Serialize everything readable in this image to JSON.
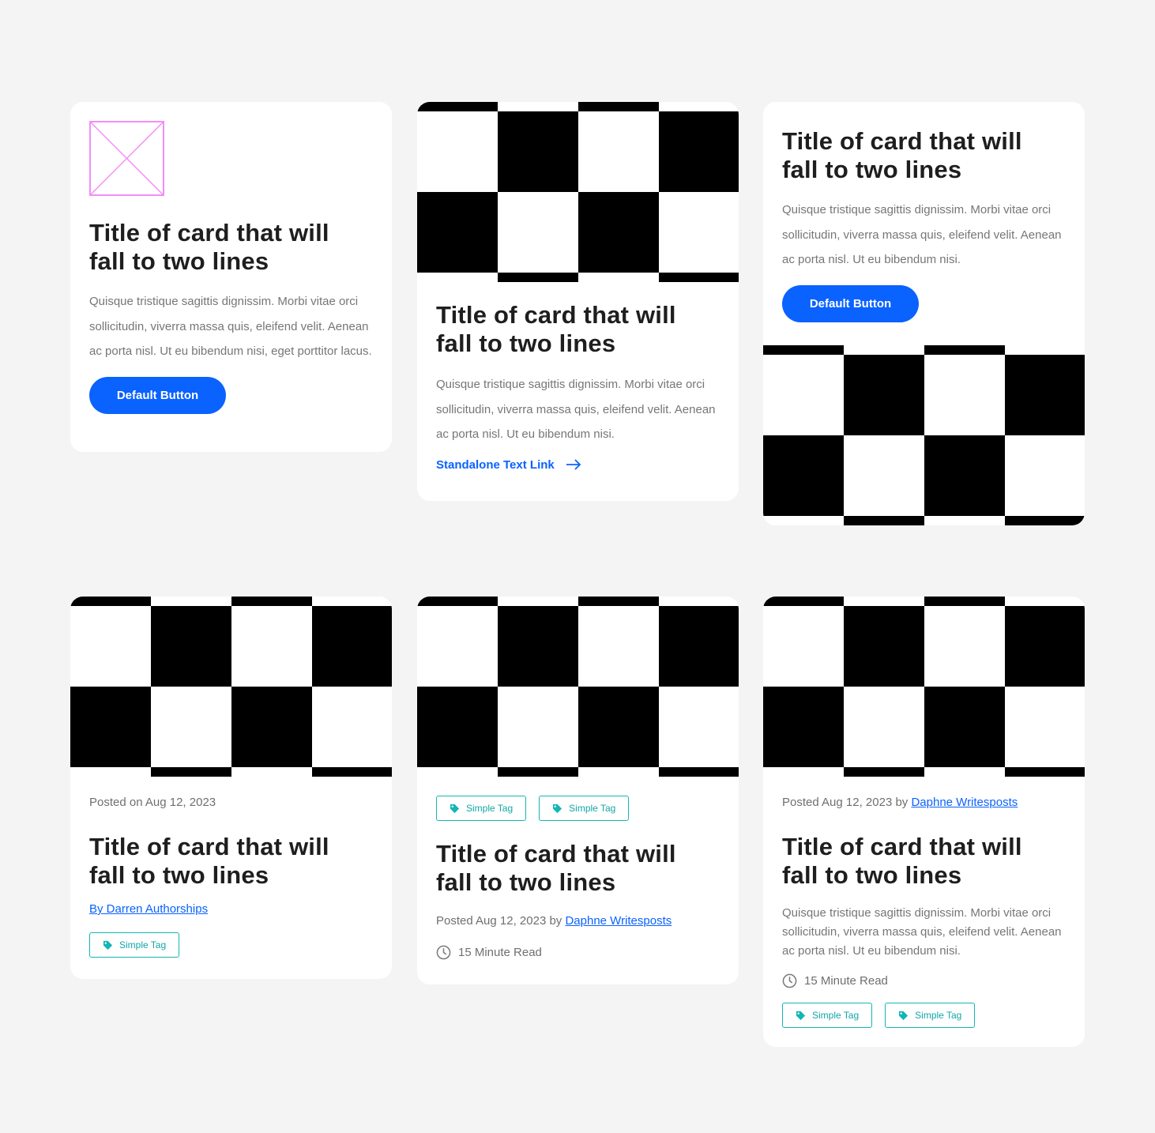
{
  "colors": {
    "background": "#f4f4f4",
    "accent": "#0a62ff",
    "tag": "#12b6b6",
    "placeholder": "#f38ef7"
  },
  "card_title": "Title of card that will fall to two lines",
  "card1": {
    "image_icon": "image-placeholder-icon",
    "desc": "Quisque tristique sagittis dignissim. Morbi vitae orci sollicitudin, viverra massa quis, eleifend velit. Aenean ac porta nisl. Ut eu bibendum nisi, eget porttitor lacus.",
    "button": "Default Button"
  },
  "card2": {
    "desc": "Quisque tristique sagittis dignissim. Morbi vitae orci sollicitudin, viverra massa quis, eleifend velit. Aenean ac porta nisl. Ut eu bibendum nisi.",
    "link": "Standalone Text Link",
    "link_icon": "arrow-right-icon"
  },
  "card3": {
    "desc": "Quisque tristique sagittis dignissim. Morbi vitae orci sollicitudin, viverra massa quis, eleifend velit. Aenean ac porta nisl. Ut eu bibendum nisi.",
    "button": "Default Button"
  },
  "card4": {
    "posted": "Posted on Aug 12, 2023",
    "author": "By Darren Authorships",
    "tag": "Simple Tag"
  },
  "card5": {
    "tags": [
      "Simple Tag",
      "Simple Tag"
    ],
    "posted_prefix": "Posted Aug 12, 2023 by",
    "author": "Daphne Writesposts",
    "read_time": "15 Minute Read"
  },
  "card6": {
    "posted_prefix": "Posted Aug 12, 2023 by",
    "author": "Daphne Writesposts",
    "desc": "Quisque tristique sagittis dignissim. Morbi vitae orci sollicitudin, viverra massa quis, eleifend velit. Aenean ac porta nisl. Ut eu bibendum nisi.",
    "read_time": "15 Minute Read",
    "tags": [
      "Simple Tag",
      "Simple Tag"
    ]
  }
}
